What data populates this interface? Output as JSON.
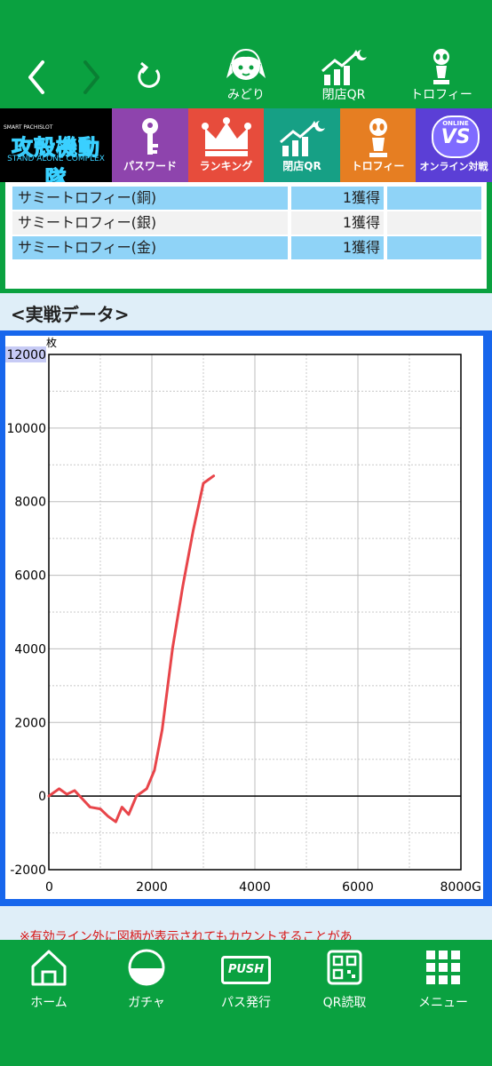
{
  "header": {
    "buttons": [
      {
        "label": "みどり",
        "icon": "character-icon"
      },
      {
        "label": "閉店QR",
        "icon": "chart-moon-icon"
      },
      {
        "label": "トロフィー",
        "icon": "trophy-figure-icon"
      }
    ]
  },
  "menu": {
    "logo": {
      "small": "SMART PACHISLOT",
      "title": "攻殻機動隊",
      "subtitle": "STAND ALONE COMPLEX"
    },
    "tiles": [
      {
        "label": "パスワード",
        "color": "#8e44ad",
        "icon": "key-icon"
      },
      {
        "label": "ランキング",
        "color": "#e74c3c",
        "icon": "crown-icon"
      },
      {
        "label": "閉店QR",
        "color": "#16a085",
        "icon": "chart-moon-icon"
      },
      {
        "label": "トロフィー",
        "color": "#e67e22",
        "icon": "trophy-figure-icon"
      },
      {
        "label": "オンライン対戦",
        "color": "#5b3fd6",
        "icon": "vs-icon",
        "badge_top": "ONLINE",
        "badge_main": "VS"
      }
    ]
  },
  "trophies": [
    {
      "name": "サミートロフィー(銅)",
      "value": "1獲得"
    },
    {
      "name": "サミートロフィー(銀)",
      "value": "1獲得"
    },
    {
      "name": "サミートロフィー(金)",
      "value": "1獲得"
    }
  ],
  "section": {
    "title": "<実戦データ>"
  },
  "chart_data": {
    "type": "line",
    "unit_y": "枚",
    "unit_x": "G",
    "xlim": [
      0,
      8000
    ],
    "ylim": [
      -2000,
      12000
    ],
    "x_ticks": [
      0,
      2000,
      4000,
      6000,
      8000
    ],
    "y_ticks": [
      -2000,
      0,
      2000,
      4000,
      6000,
      8000,
      10000,
      12000
    ],
    "x_tick_labels": [
      "0",
      "2000",
      "4000",
      "6000",
      "8000G"
    ],
    "y_tick_labels": [
      "-2000",
      "0",
      "2000",
      "4000",
      "6000",
      "8000",
      "10000",
      "12000"
    ],
    "grid": true,
    "series": [
      {
        "color": "#e8454a",
        "x": [
          0,
          150,
          200,
          350,
          500,
          600,
          800,
          1000,
          1150,
          1300,
          1420,
          1550,
          1700,
          1900,
          2050,
          2200,
          2400,
          2600,
          2800,
          3000,
          3100,
          3200
        ],
        "values": [
          0,
          150,
          200,
          50,
          150,
          0,
          -300,
          -350,
          -550,
          -700,
          -300,
          -500,
          0,
          200,
          700,
          1800,
          4000,
          5700,
          7200,
          8500,
          8600,
          8700
        ]
      }
    ]
  },
  "notice": "※有効ライン外に図柄が表示されてもカウントすることがあ",
  "bottom_nav": [
    {
      "label": "ホーム",
      "icon": "home-icon"
    },
    {
      "label": "ガチャ",
      "icon": "gacha-icon"
    },
    {
      "label": "パス発行",
      "icon": "push-pass-icon",
      "badge": "PUSH"
    },
    {
      "label": "QR読取",
      "icon": "qr-code-icon"
    },
    {
      "label": "メニュー",
      "icon": "menu-grid-icon"
    }
  ]
}
